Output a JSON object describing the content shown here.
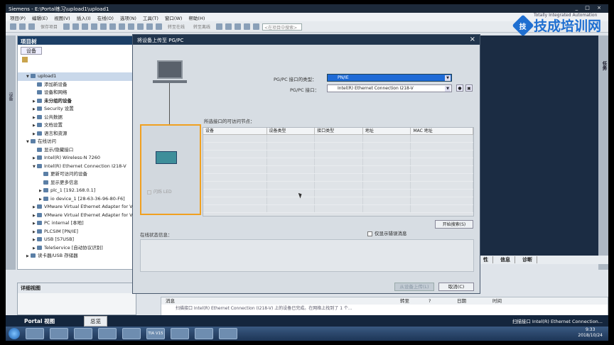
{
  "window": {
    "title": "Siemens  -  E:\\Portal练习\\upload1\\upload1"
  },
  "menu": [
    "项目(P)",
    "编辑(E)",
    "视图(V)",
    "插入(I)",
    "在线(O)",
    "选项(N)",
    "工具(T)",
    "窗口(W)",
    "帮助(H)"
  ],
  "toolbar": {
    "save_label": "保存项目",
    "go_online": "转至在线",
    "go_offline": "转至离线",
    "search_placeholder": "<在项目中搜索>"
  },
  "brand": {
    "name": "技成培训网",
    "tagline": "Totally Integrated Automation",
    "logo_glyph": "技"
  },
  "tree": {
    "header": "项目树",
    "tab": "设备",
    "items": [
      {
        "label": "upload1",
        "level": 0,
        "arrow": "▼",
        "selected": true
      },
      {
        "label": "添加新设备",
        "level": 1,
        "arrow": ""
      },
      {
        "label": "设备和网络",
        "level": 1,
        "arrow": ""
      },
      {
        "label": "未分组的设备",
        "level": 1,
        "arrow": "▶",
        "bold": true
      },
      {
        "label": "Security 设置",
        "level": 1,
        "arrow": "▶"
      },
      {
        "label": "公共数据",
        "level": 1,
        "arrow": "▶"
      },
      {
        "label": "文档设置",
        "level": 1,
        "arrow": "▶"
      },
      {
        "label": "语言和资源",
        "level": 1,
        "arrow": "▶"
      },
      {
        "label": "在线访问",
        "level": 0,
        "arrow": "▼"
      },
      {
        "label": "显示/隐藏接口",
        "level": 1,
        "arrow": ""
      },
      {
        "label": "Intel(R) Wireless-N 7260",
        "level": 1,
        "arrow": "▶"
      },
      {
        "label": "Intel(R) Ethernet Connection I218-V",
        "level": 1,
        "arrow": "▼"
      },
      {
        "label": "更新可访问的设备",
        "level": 2,
        "arrow": ""
      },
      {
        "label": "显示更多信息",
        "level": 2,
        "arrow": ""
      },
      {
        "label": "plc_1 [192.168.0.1]",
        "level": 2,
        "arrow": "▶"
      },
      {
        "label": "io device_1 [28-63-36-96-80-F6]",
        "level": 2,
        "arrow": "▶"
      },
      {
        "label": "VMware Virtual Ethernet Adapter for V",
        "level": 1,
        "arrow": "▶"
      },
      {
        "label": "VMware Virtual Ethernet Adapter for V",
        "level": 1,
        "arrow": "▶"
      },
      {
        "label": "PC internal [本地]",
        "level": 1,
        "arrow": "▶"
      },
      {
        "label": "PLCSIM [PN/IE]",
        "level": 1,
        "arrow": "▶"
      },
      {
        "label": "USB [S7USB]",
        "level": 1,
        "arrow": "▶"
      },
      {
        "label": "TeleService [自动协议识别]",
        "level": 1,
        "arrow": "▶"
      },
      {
        "label": "读卡器/USB 存储器",
        "level": 0,
        "arrow": "▶"
      }
    ]
  },
  "left_strip_label": "设备",
  "detail": {
    "header": "详细视图"
  },
  "right_strip_label": "任务",
  "inspector_tabs": [
    "性",
    "信息",
    "诊断"
  ],
  "messages": {
    "columns": [
      "消息",
      "转至",
      "?",
      "日期",
      "时间"
    ],
    "row": "扫描接口 Intel(R) Ethernet Connection (I218-V) 上的设备已完成。在网络上找到了 1 个..."
  },
  "portal": {
    "label": "Portal 视图",
    "overview": "总览",
    "status": "扫描接口 Intel(R) Ethernet Connection..."
  },
  "taskbar": {
    "tia_label": "TIA V15",
    "time": "9:33",
    "date": "2018/10/24"
  },
  "dialog": {
    "title": "将设备上传至 PG/PC",
    "close": "×",
    "iface_type_label": "PG/PC 接口的类型：",
    "iface_type_value": "PN/IE",
    "iface_label": "PG/PC 接口：",
    "iface_value": "Intel(R) Ethernet Connection I218-V",
    "nodes_label": "所选接口的可访问节点：",
    "columns": [
      "设备",
      "设备类型",
      "接口类型",
      "地址",
      "MAC 地址"
    ],
    "flash_led": "闪烁 LED",
    "start_search": "开始搜索(S)",
    "online_status": "在线状态信息：",
    "errors_only": "仅显示错误消息",
    "upload_btn": "从设备上传(L)",
    "cancel_btn": "取消(C)"
  }
}
